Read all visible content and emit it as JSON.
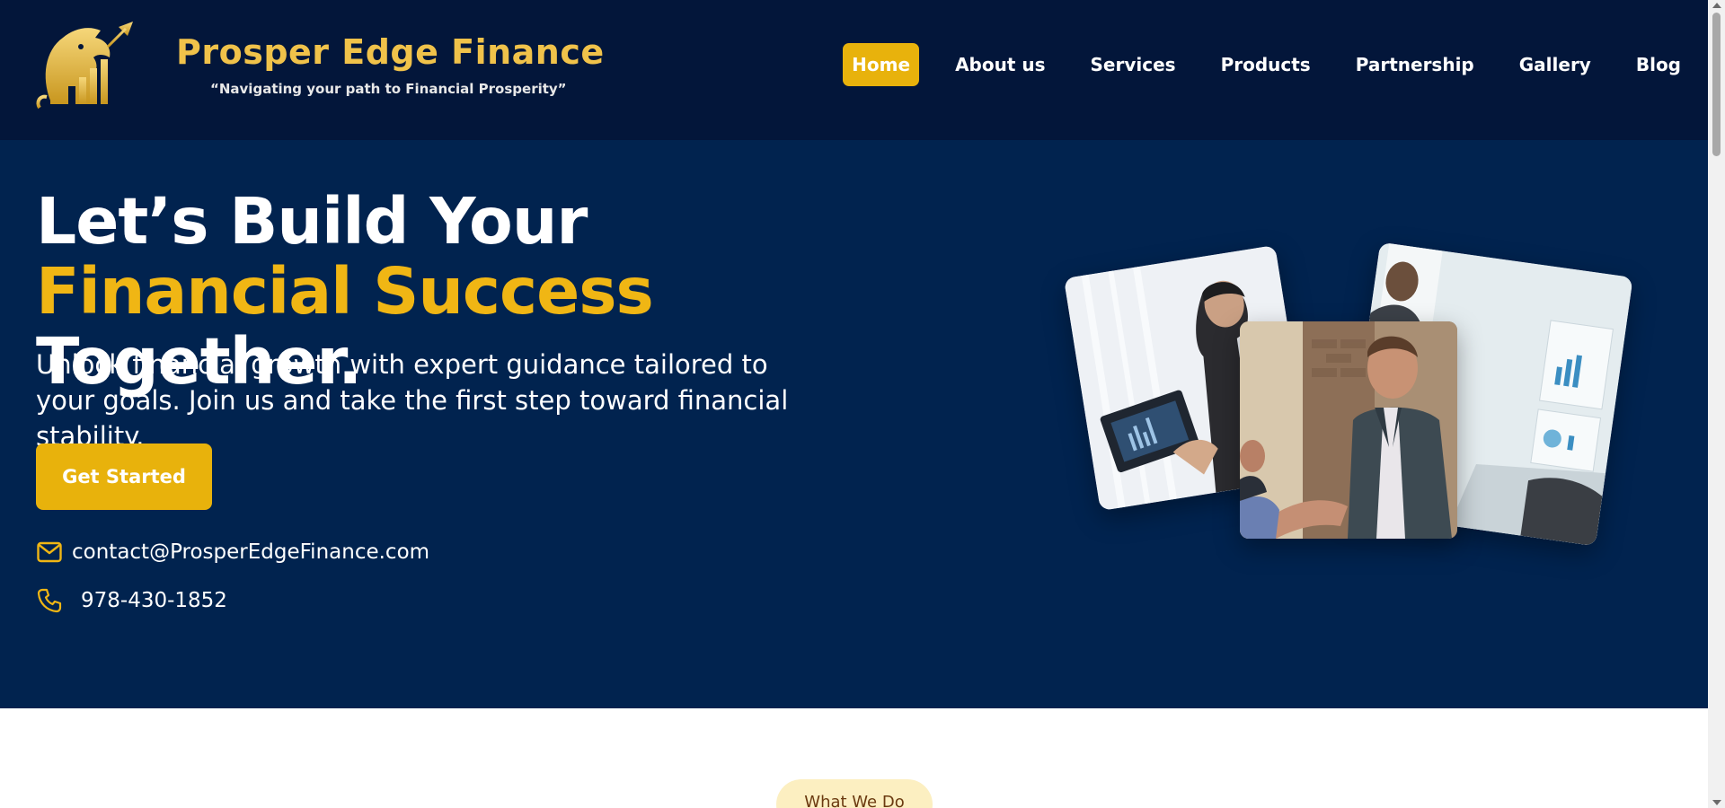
{
  "brand": {
    "name": "Prosper Edge Finance",
    "tagline": "“Navigating your path to Financial Prosperity”",
    "logo_icon": "lion-chart-logo-icon"
  },
  "nav": {
    "items": [
      {
        "label": "Home",
        "active": true
      },
      {
        "label": "About us",
        "active": false
      },
      {
        "label": "Services",
        "active": false
      },
      {
        "label": "Products",
        "active": false
      },
      {
        "label": "Partnership",
        "active": false
      },
      {
        "label": "Gallery",
        "active": false
      },
      {
        "label": "Blog",
        "active": false
      }
    ]
  },
  "hero": {
    "title_part1": "Let’s Build Your ",
    "title_accent1": "Financial Success",
    "title_part2": " Together.",
    "subtitle": "Unlock financial growth with expert guidance tailored to your goals. Join us and take the first step toward financial stability.",
    "cta_label": "Get Started",
    "email": "contact@ProsperEdgeFinance.com",
    "phone": "978-430-1852",
    "images": [
      "office-laptop-meeting-photo",
      "business-handshake-photo",
      "team-meeting-photo"
    ]
  },
  "section": {
    "badge": "What We Do"
  },
  "colors": {
    "header_bg": "#03163a",
    "hero_bg": "#01234f",
    "accent": "#e8b20c",
    "accent_text": "#f0b614",
    "badge_bg": "#fcefc1"
  }
}
